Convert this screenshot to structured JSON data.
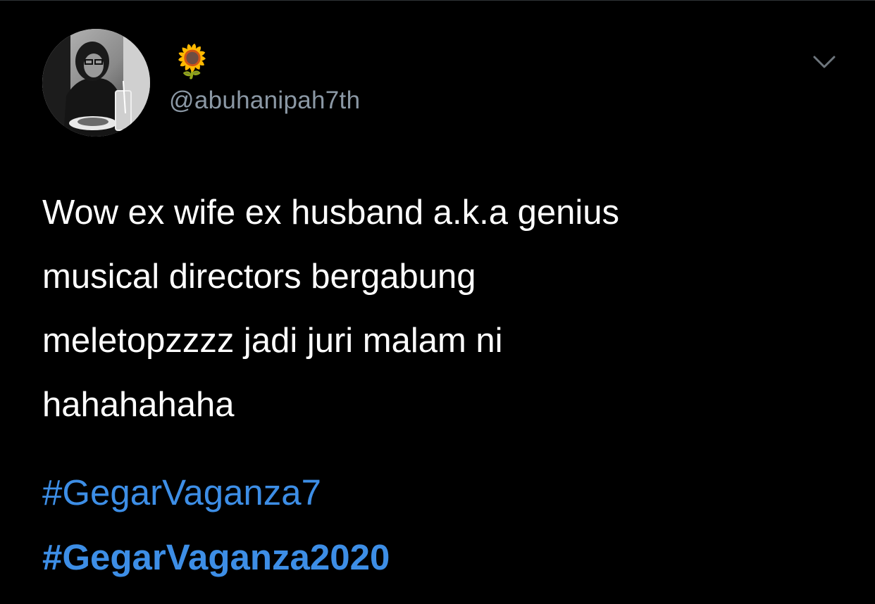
{
  "tweet": {
    "display_name": "🌻",
    "username": "@abuhanipah7th",
    "text_lines": [
      "Wow ex wife ex husband a.k.a genius",
      "musical directors bergabung",
      "meletopzzzz jadi juri malam ni",
      "hahahahaha"
    ],
    "hashtags": [
      "#GegarVaganza7",
      "#GegarVaganza2020"
    ]
  },
  "icons": {
    "avatar": "profile-photo",
    "menu": "chevron-down-icon"
  },
  "colors": {
    "background": "#000000",
    "text": "#ffffff",
    "secondary_text": "#8b98a5",
    "hashtag": "#3d8ee6"
  }
}
